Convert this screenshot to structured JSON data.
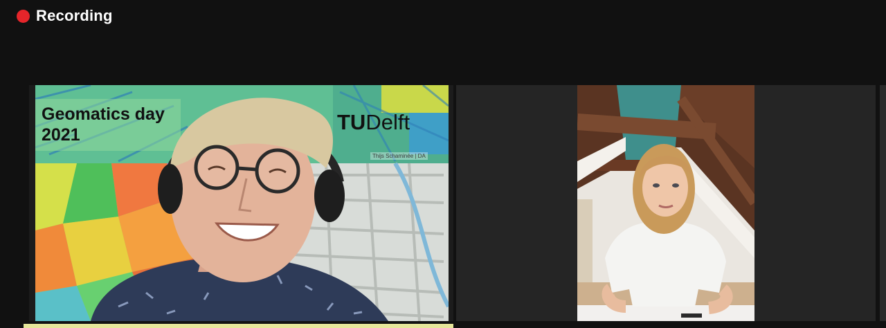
{
  "recording": {
    "label": "Recording",
    "indicator_color": "#e5252a"
  },
  "gallery": {
    "active_speaker_highlight_color": "#e6e69a",
    "tiles": [
      {
        "role": "active-speaker",
        "background": {
          "slide_title_line1": "Geomatics day",
          "slide_title_line2": "2021",
          "logo_strong": "TU",
          "logo_rest": "Delft",
          "caption": "Thijs Schaminée | DA"
        }
      },
      {
        "role": "participant"
      }
    ]
  },
  "icons": {
    "recording-indicator": "red-dot"
  }
}
